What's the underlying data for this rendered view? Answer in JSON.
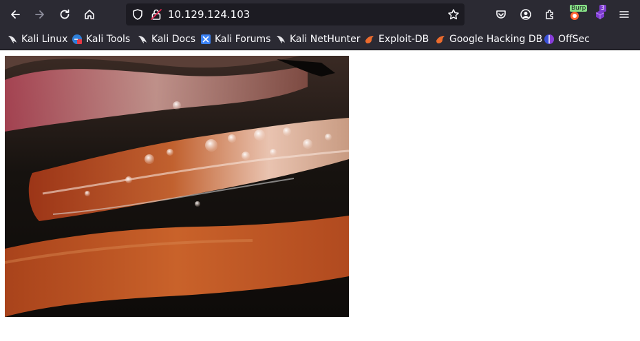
{
  "browser": {
    "url": "10.129.124.103",
    "extension_badges": {
      "burp": "Burp",
      "notifications": "3"
    }
  },
  "bookmarks": [
    {
      "label": "Kali Linux",
      "icon": "kali-dragon-icon"
    },
    {
      "label": "Kali Tools",
      "icon": "kali-tools-icon"
    },
    {
      "label": "Kali Docs",
      "icon": "kali-dragon-icon"
    },
    {
      "label": "Kali Forums",
      "icon": "kali-forums-icon"
    },
    {
      "label": "Kali NetHunter",
      "icon": "kali-dragon-icon"
    },
    {
      "label": "Exploit-DB",
      "icon": "exploit-db-icon"
    },
    {
      "label": "Google Hacking DB",
      "icon": "exploit-db-icon"
    },
    {
      "label": "OffSec",
      "icon": "offsec-icon"
    }
  ],
  "colors": {
    "chrome_bg": "#2b2a33",
    "urlbar_bg": "#1c1b22",
    "text": "#fbfbfe",
    "page_bg": "#ffffff"
  }
}
